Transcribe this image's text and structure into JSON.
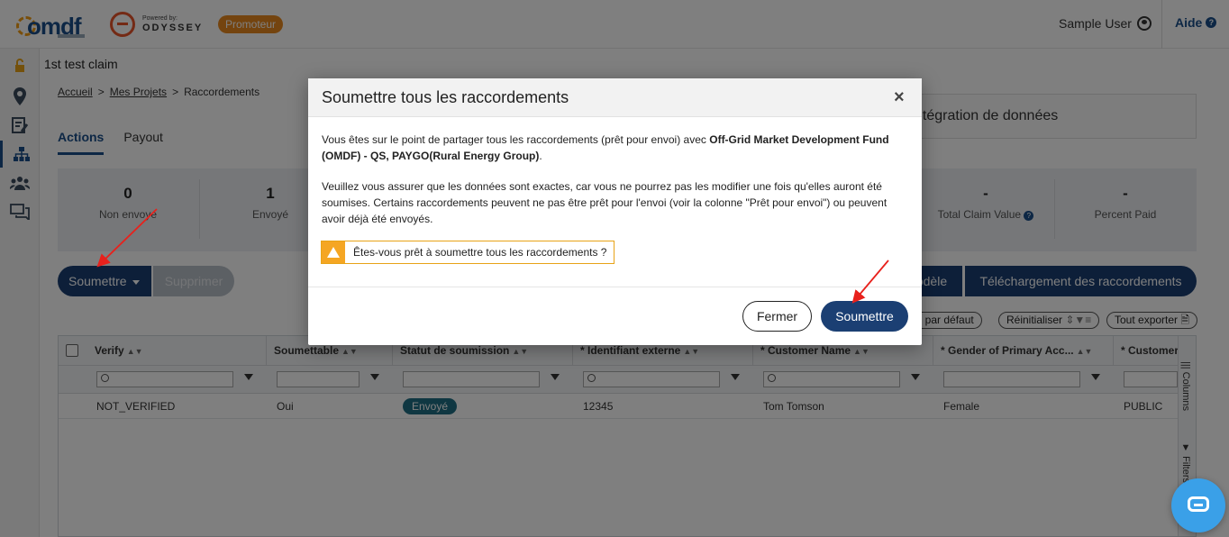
{
  "header": {
    "logo_text": "omdf",
    "powered_by": "Powered by:",
    "odyssey": "ODYSSEY",
    "role_badge": "Promoteur",
    "user_name": "Sample User",
    "help_label": "Aide"
  },
  "page": {
    "title": "1st test claim",
    "breadcrumb": [
      "Accueil",
      "Mes Projets",
      "Raccordements"
    ],
    "breadcrumb_sep": ">",
    "tabs": [
      {
        "label": "Actions",
        "active": true
      },
      {
        "label": "Payout",
        "active": false
      }
    ],
    "import_box_label": "ntégration de données"
  },
  "stats": [
    {
      "value": "0",
      "label": "Non envoyé"
    },
    {
      "value": "1",
      "label": "Envoyé"
    },
    {
      "value": "-",
      "label": "Total Claim Value"
    },
    {
      "value": "-",
      "label": "Percent Paid"
    }
  ],
  "toolbar": {
    "submit_label": "Soumettre",
    "delete_label": "Supprimer",
    "model_label": "odèle",
    "download_label": "Téléchargement des raccordements",
    "pill_default": "ge par défaut",
    "pill_reset": "Réinitialiser",
    "pill_export": "Tout exporter"
  },
  "grid": {
    "columns": [
      "Verify",
      "Soumettable",
      "Statut de soumission",
      "* Identifiant externe",
      "* Customer Name",
      "* Gender of Primary Acc...",
      "* Customer"
    ],
    "rows": [
      [
        "NOT_VERIFIED",
        "Oui",
        "Envoyé",
        "12345",
        "Tom Tomson",
        "Female",
        "PUBLIC"
      ]
    ],
    "side_columns": "Columns",
    "side_filters": "Filters"
  },
  "modal": {
    "title": "Soumettre tous les raccordements",
    "close_symbol": "×",
    "p1_prefix": "Vous êtes sur le point de partager tous les raccordements (prêt pour envoi) avec ",
    "p1_bold": "Off-Grid Market Development Fund (OMDF) - QS, PAYGO(Rural Energy Group)",
    "p1_suffix": ".",
    "p2": "Veuillez vous assurer que les données sont exactes, car vous ne pourrez pas les modifier une fois qu'elles auront été soumises. Certains raccordements peuvent ne pas être prêt pour l'envoi (voir la colonne \"Prêt pour envoi\") ou peuvent avoir déjà été envoyés.",
    "warning": "Êtes-vous prêt à soumettre tous les raccordements ?",
    "cancel_label": "Fermer",
    "confirm_label": "Soumettre"
  },
  "colors": {
    "primary": "#1b3f73",
    "badge": "#e8891e",
    "status": "#1f6f84",
    "warning": "#f5a623",
    "arrow": "#e8211c"
  }
}
